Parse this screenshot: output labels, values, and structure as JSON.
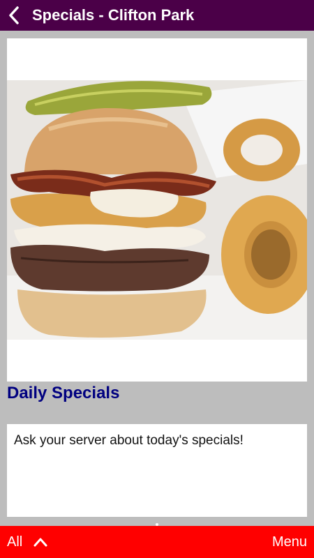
{
  "header": {
    "title": "Specials - Clifton Park",
    "back_icon": "back-arrow-icon"
  },
  "content": {
    "image_alt": "burger-with-onion-rings-photo",
    "section_title": "Daily Specials",
    "body_text": "Ask your server about today's specials!"
  },
  "bottom_bar": {
    "all_label": "All",
    "expand_icon": "chevron-up-icon",
    "menu_label": "Menu"
  },
  "colors": {
    "header_bg": "#4b0048",
    "bottom_bar_bg": "#ff0000",
    "section_title": "#000080",
    "page_bg": "#bdbdbd"
  }
}
